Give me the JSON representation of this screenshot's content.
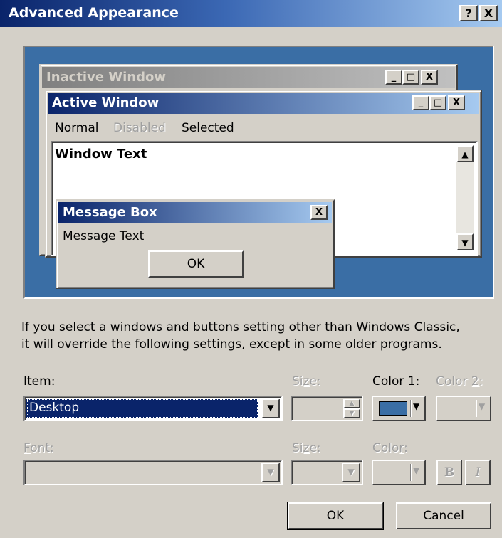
{
  "dialog": {
    "title": "Advanced Appearance",
    "help_btn": "?",
    "close_btn": "X"
  },
  "preview": {
    "inactive_window": {
      "title": "Inactive Window"
    },
    "active_window": {
      "title": "Active Window",
      "menu": [
        "Normal",
        "Disabled",
        "Selected"
      ],
      "window_text": "Window Text"
    },
    "message_box": {
      "title": "Message Box",
      "text": "Message Text",
      "ok": "OK"
    },
    "caption_buttons": {
      "min": "_",
      "max": "□",
      "close": "X"
    }
  },
  "info_text": [
    "If you select a windows and buttons setting other than Windows Classic,",
    "it will override the following settings, except in some older programs."
  ],
  "item": {
    "label_pre": "",
    "label_u": "I",
    "label_post": "tem:",
    "value": "Desktop"
  },
  "size1": {
    "label_pre": "Si",
    "label_u": "z",
    "label_post": "e:"
  },
  "color1": {
    "label_pre": "Co",
    "label_u": "l",
    "label_post": "or 1:",
    "swatch": "#3a6ea5"
  },
  "color2": {
    "label_pre": "Color ",
    "label_u": "2",
    "label_post": ":"
  },
  "font": {
    "label_pre": "",
    "label_u": "F",
    "label_post": "ont:"
  },
  "size2": {
    "label_pre": "Si",
    "label_u": "z",
    "label_post": "e:"
  },
  "color3": {
    "label_pre": "Colo",
    "label_u": "r",
    "label_post": ":"
  },
  "style_buttons": {
    "bold": "B",
    "italic": "I"
  },
  "buttons": {
    "ok": "OK",
    "cancel": "Cancel"
  }
}
